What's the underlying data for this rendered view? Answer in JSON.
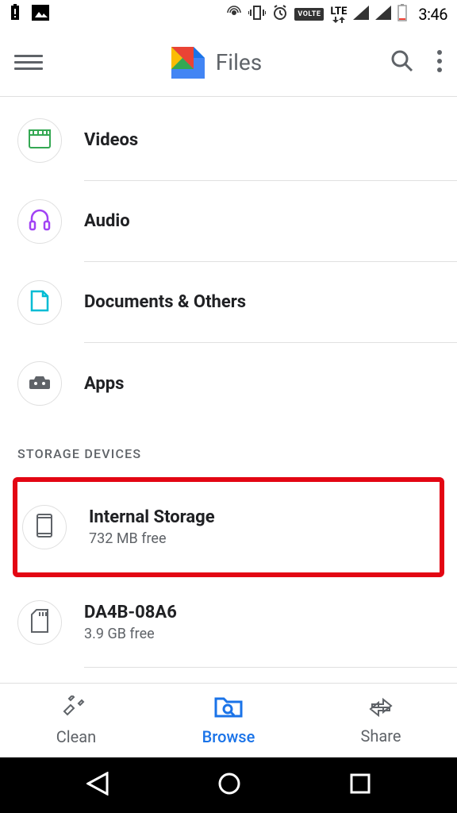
{
  "status_bar": {
    "time": "3:46",
    "volte": "VOLTE",
    "lte": "LTE"
  },
  "app": {
    "title": "Files"
  },
  "categories": [
    {
      "label": "Videos",
      "icon": "videos"
    },
    {
      "label": "Audio",
      "icon": "audio"
    },
    {
      "label": "Documents & Others",
      "icon": "documents"
    },
    {
      "label": "Apps",
      "icon": "apps"
    }
  ],
  "section_header": "STORAGE DEVICES",
  "storage_devices": [
    {
      "name": "Internal Storage",
      "subtitle": "732 MB free",
      "icon": "phone"
    },
    {
      "name": "DA4B-08A6",
      "subtitle": "3.9 GB free",
      "icon": "sd"
    }
  ],
  "bottom_nav": {
    "clean": "Clean",
    "browse": "Browse",
    "share": "Share"
  }
}
